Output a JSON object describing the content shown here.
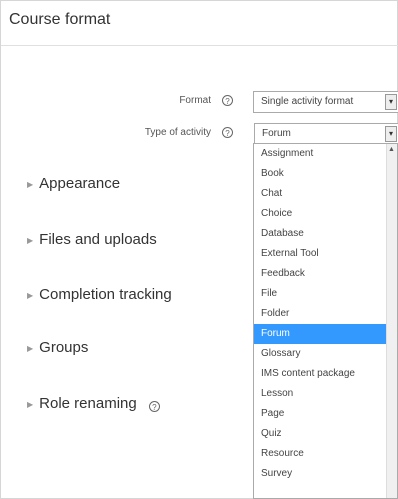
{
  "section": {
    "title": "Course format"
  },
  "format_field": {
    "label": "Format",
    "value": "Single activity format"
  },
  "activity_field": {
    "label": "Type of activity",
    "value": "Forum"
  },
  "help_glyph": "?",
  "arrow_glyph": "▾",
  "collapsibles": [
    {
      "label": "Appearance"
    },
    {
      "label": "Files and uploads"
    },
    {
      "label": "Completion tracking"
    },
    {
      "label": "Groups"
    },
    {
      "label": "Role renaming"
    }
  ],
  "dropdown": {
    "options": [
      "Assignment",
      "Book",
      "Chat",
      "Choice",
      "Database",
      "External Tool",
      "Feedback",
      "File",
      "Folder",
      "Forum",
      "Glossary",
      "IMS content package",
      "Lesson",
      "Page",
      "Quiz",
      "Resource",
      "Survey"
    ],
    "selected": "Forum"
  },
  "colors": {
    "selected_bg": "#3399ff",
    "border": "#aaaaaa"
  }
}
